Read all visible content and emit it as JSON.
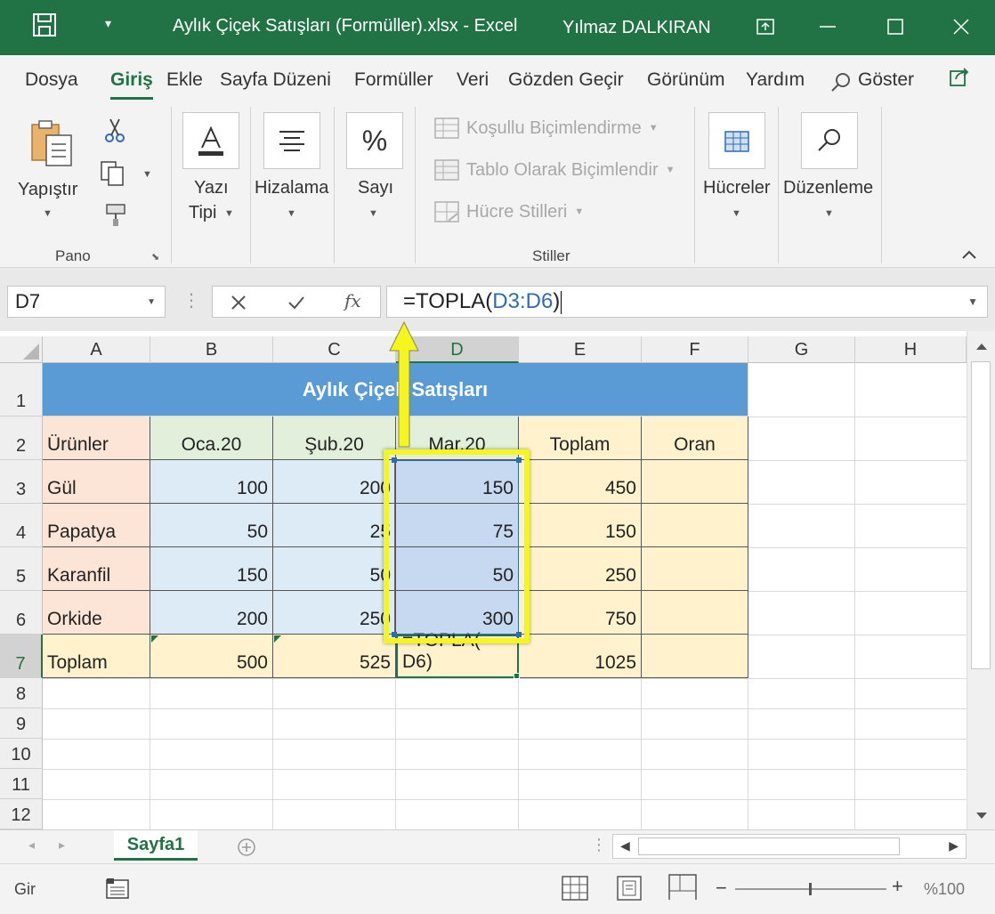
{
  "window": {
    "title": "Aylık Çiçek Satışları (Formüller).xlsx  -  Excel",
    "user": "Yılmaz DALKIRAN"
  },
  "tabs": [
    "Dosya",
    "Giriş",
    "Ekle",
    "Sayfa Düzeni",
    "Formüller",
    "Veri",
    "Gözden Geçir",
    "Görünüm",
    "Yardım",
    "Göster"
  ],
  "ribbon": {
    "paste_label": "Yapıştır",
    "pano_label": "Pano",
    "font_label_1": "Yazı",
    "font_label_2": "Tipi",
    "align_label": "Hizalama",
    "number_label": "Sayı",
    "cond_format": "Koşullu Biçimlendirme",
    "table_format": "Tablo Olarak Biçimlendir",
    "cell_styles": "Hücre Stilleri",
    "styles_label": "Stiller",
    "cells_label": "Hücreler",
    "editing_label": "Düzenleme"
  },
  "formula_bar": {
    "name_box": "D7",
    "formula_prefix": "=TOPLA(",
    "formula_ref": "D3:D6",
    "formula_suffix": ")"
  },
  "columns": [
    "A",
    "B",
    "C",
    "D",
    "E",
    "F",
    "G",
    "H"
  ],
  "rows": [
    "1",
    "2",
    "3",
    "4",
    "5",
    "6",
    "7",
    "8",
    "9",
    "10",
    "11",
    "12"
  ],
  "sheet": {
    "title": "Aylık Çiçek Satışları",
    "headers": [
      "Ürünler",
      "Oca.20",
      "Şub.20",
      "Mar.20",
      "Toplam",
      "Oran"
    ],
    "data": [
      [
        "Gül",
        "100",
        "200",
        "150",
        "450"
      ],
      [
        "Papatya",
        "50",
        "25",
        "75",
        "150"
      ],
      [
        "Karanfil",
        "150",
        "50",
        "50",
        "250"
      ],
      [
        "Orkide",
        "200",
        "250",
        "300",
        "750"
      ]
    ],
    "total_label": "Toplam",
    "totals": [
      "500",
      "525",
      "",
      "1025"
    ],
    "d7_overflow_line1": "=TOPLA(",
    "d7_overflow_line2": "D6)"
  },
  "sheet_tab": "Sayfa1",
  "status": {
    "mode": "Gir",
    "zoom": "%100"
  },
  "colors": {
    "excel_green": "#217346",
    "title_fill": "#5b9bd5",
    "product_fill": "#fce4d6",
    "data_fill": "#ddebf7",
    "month_header_fill": "#e2efda",
    "total_fill": "#fff2cc",
    "highlight": "#f5f520"
  }
}
